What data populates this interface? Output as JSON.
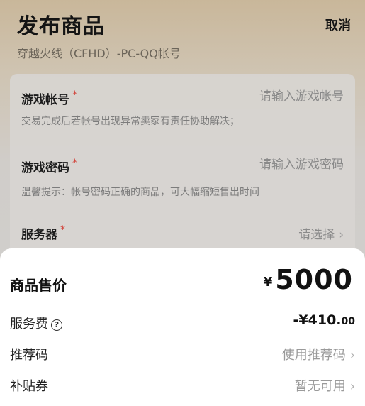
{
  "header": {
    "title": "发布商品",
    "cancel_label": "取消",
    "subtitle": "穿越火线（CFHD）-PC-QQ帐号"
  },
  "form": {
    "account": {
      "label": "游戏帐号",
      "required_mark": "*",
      "placeholder": "请输入游戏帐号",
      "hint": "交易完成后若帐号出现异常卖家有责任协助解决；"
    },
    "password": {
      "label": "游戏密码",
      "required_mark": "*",
      "placeholder": "请输入游戏密码",
      "hint": "温馨提示：帐号密码正确的商品，可大幅缩短售出时间"
    },
    "server": {
      "label": "服务器",
      "required_mark": "*",
      "value": "请选择"
    }
  },
  "sheet": {
    "price_label": "商品售价",
    "price_currency": "¥",
    "price_value": "5000",
    "service_fee_label": "服务费",
    "help_icon_glyph": "?",
    "service_fee_main": "-¥410.",
    "service_fee_decimal": "00",
    "referral_label": "推荐码",
    "referral_action": "使用推荐码",
    "coupon_label": "补贴券",
    "coupon_action": "暂无可用"
  },
  "icons": {
    "chevron": "›"
  }
}
